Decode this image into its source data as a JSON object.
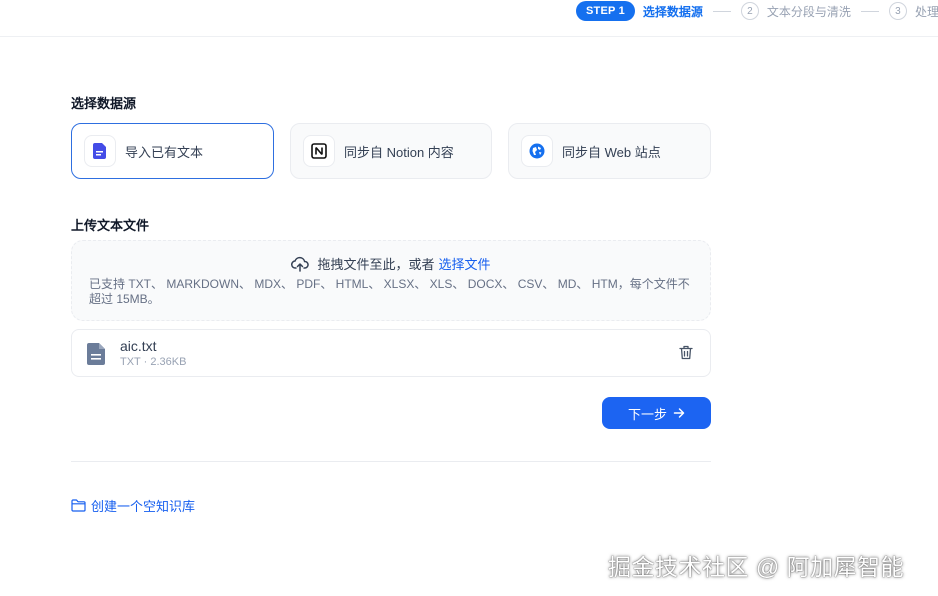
{
  "stepper": {
    "step1_badge": "STEP 1",
    "step1_label": "选择数据源",
    "step2_num": "2",
    "step2_label": "文本分段与清洗",
    "step3_num": "3",
    "step3_label": "处理"
  },
  "datasource": {
    "title": "选择数据源",
    "options": [
      {
        "label": "导入已有文本",
        "icon": "file-text-icon",
        "selected": true
      },
      {
        "label": "同步自 Notion 内容",
        "icon": "notion-icon",
        "selected": false
      },
      {
        "label": "同步自 Web 站点",
        "icon": "web-icon",
        "selected": false
      }
    ]
  },
  "upload": {
    "title": "上传文本文件",
    "drag_text": "拖拽文件至此，或者",
    "select_link": "选择文件",
    "tip": "已支持 TXT、 MARKDOWN、 MDX、 PDF、 HTML、 XLSX、 XLS、 DOCX、 CSV、 MD、 HTM，每个文件不超过 15MB。"
  },
  "file": {
    "name": "aic.txt",
    "meta": "TXT · 2.36KB"
  },
  "actions": {
    "next_label": "下一步",
    "create_empty_label": "创建一个空知识库"
  },
  "watermark": "掘金技术社区 @ 阿加犀智能",
  "colors": {
    "accent": "#1570ef",
    "button": "#1c64f2",
    "link": "#155eef"
  }
}
